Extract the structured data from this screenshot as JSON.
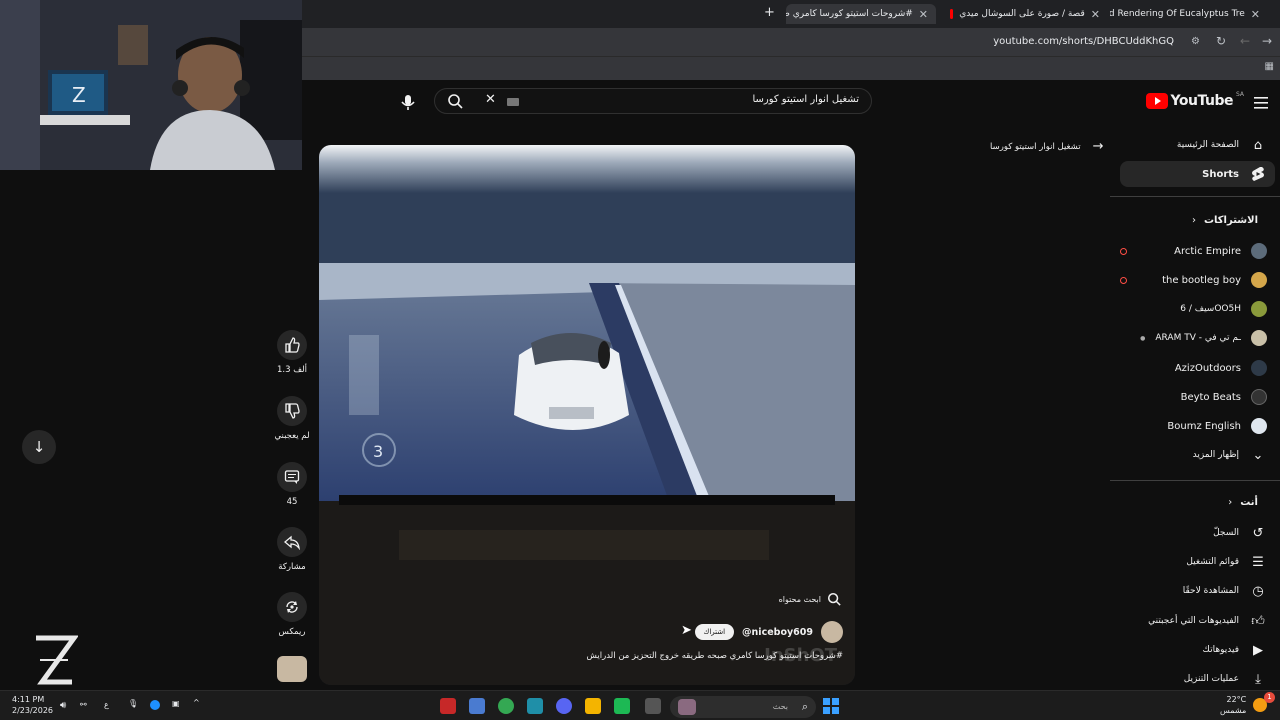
{
  "browser": {
    "tabs": [
      {
        "label": "3d Rendering Of Eucalyptus Tre"
      },
      {
        "label": "قصة / صورة على السوشال ميدي"
      },
      {
        "label": "#شروحات استيتو كورسا كامري ص"
      }
    ],
    "new_tab": "+",
    "url": "youtube.com/shorts/DHBCUddKhGQ"
  },
  "youtube": {
    "logo_text": "YouTube",
    "region": "SA",
    "search_value": "تشغيل انوار استيتو كورسا",
    "suggestion": "تشغيل انوار استيتو كورسا"
  },
  "sidebar": {
    "main": [
      {
        "label": "الصفحة الرئيسية",
        "icon": "home-icon"
      },
      {
        "label": "Shorts",
        "icon": "shorts-icon"
      }
    ],
    "subscriptions_title": "الاشتراكات",
    "subscriptions": [
      {
        "label": "Arctic Empire",
        "live": true,
        "color": "#5c6b7a"
      },
      {
        "label": "the bootleg boy",
        "live": true,
        "color": "#d4a64a"
      },
      {
        "label": "سيف / 6OO5H",
        "live": false,
        "color": "#8a9a3b"
      },
      {
        "label": "ARAM TV - ـم تي في",
        "live": false,
        "color": "#c9c0a8"
      },
      {
        "label": "AzizOutdoors",
        "live": false,
        "color": "#2e3a48"
      },
      {
        "label": "Beyto Beats",
        "live": false,
        "color": "#333333"
      },
      {
        "label": "Boumz English",
        "live": false,
        "color": "#dfe6ee"
      }
    ],
    "show_more": "إظهار المزيد",
    "you_title": "أنت",
    "you_items": [
      {
        "label": "السجلّ",
        "icon": "history-icon"
      },
      {
        "label": "قوائم التشغيل",
        "icon": "playlist-icon"
      },
      {
        "label": "المشاهدة لاحقًا",
        "icon": "clock-icon"
      },
      {
        "label": "الفيديوهات التي أعجبتني",
        "icon": "thumb-up-icon"
      },
      {
        "label": "فيديوهاتك",
        "icon": "video-icon"
      },
      {
        "label": "عمليات التنزيل",
        "icon": "download-icon"
      }
    ]
  },
  "short": {
    "search_similar": "ابحث محتواه",
    "channel": "@niceboy609",
    "subscribe": "اشتراك",
    "title": "#شروحات استيتو كورسا كامري صبحه طريقه خروج التحزيز من الدرايش",
    "watermark": "InShOT",
    "gear_number": "3"
  },
  "actions": {
    "likes": "1.3 ألف",
    "dislike": "لم يعجبني",
    "comments": "45",
    "share": "مشاركة",
    "remix": "ريمكس"
  },
  "taskbar": {
    "time": "4:11 PM",
    "date": "2/23/2026",
    "weather_temp": "22°C",
    "weather_desc": "مشمس",
    "search_placeholder": "بحث",
    "lang": "ع",
    "notif_count": "1"
  }
}
